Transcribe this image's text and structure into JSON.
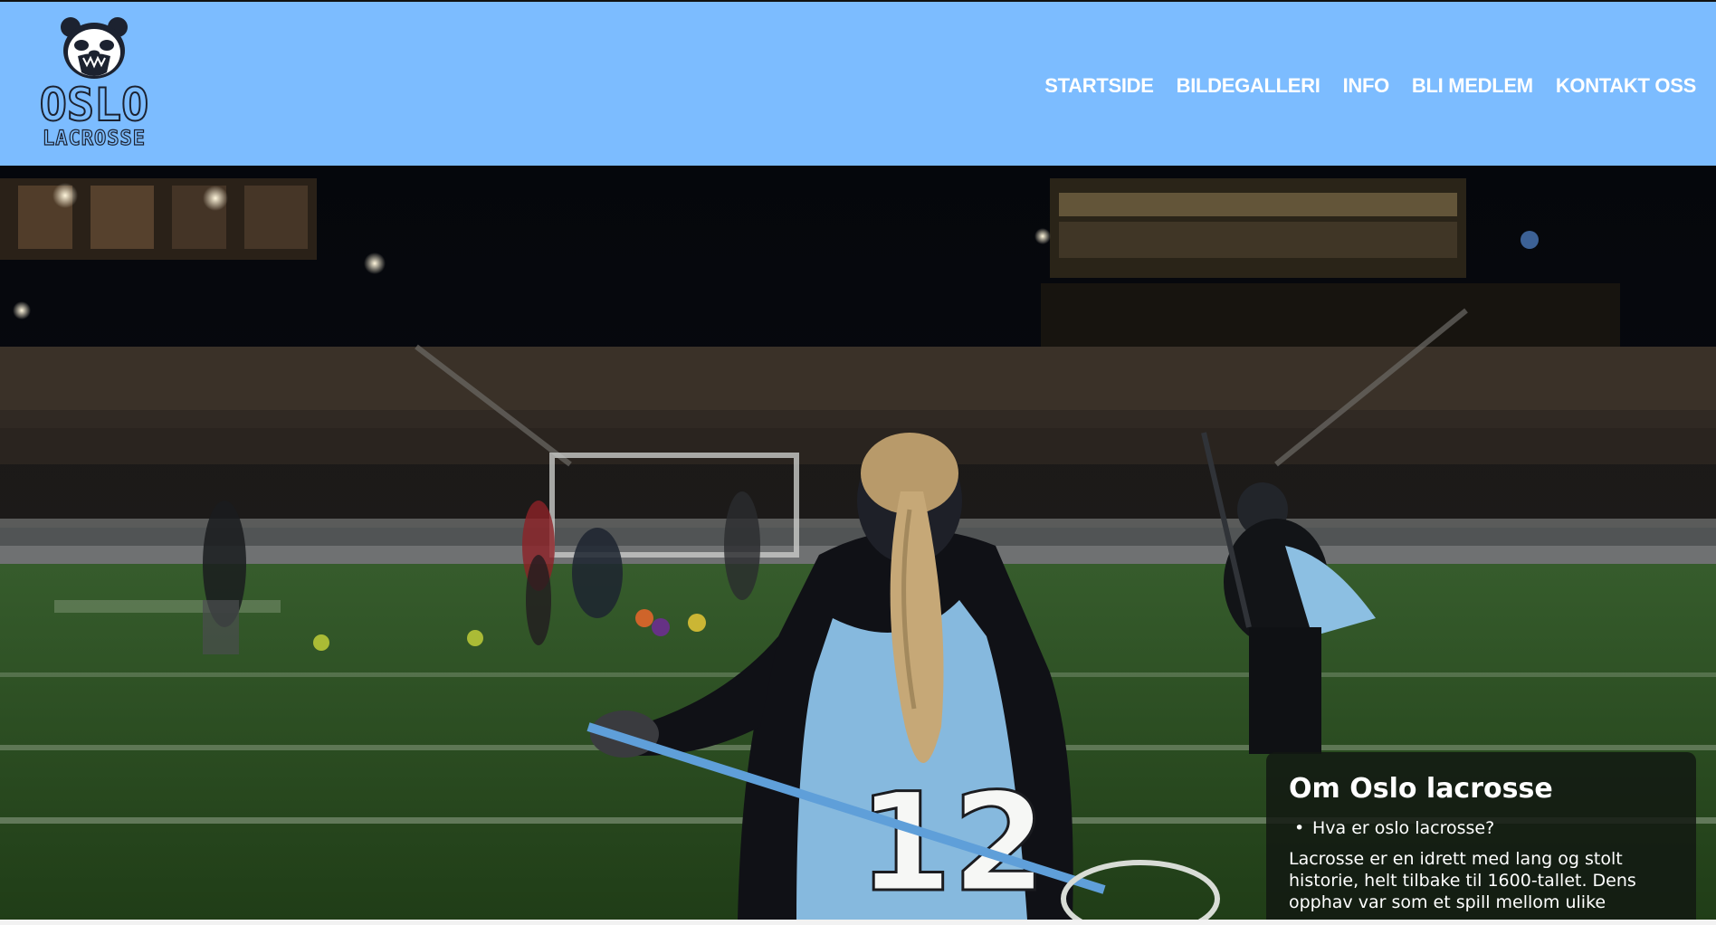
{
  "logo": {
    "word1": "OSLO",
    "word2": "LACROSSE",
    "icon": "panda-icon"
  },
  "nav": {
    "items": [
      {
        "label": "STARTSIDE"
      },
      {
        "label": "BILDEGALLERI"
      },
      {
        "label": "INFO"
      },
      {
        "label": "BLI MEDLEM"
      },
      {
        "label": "KONTAKT OSS"
      }
    ]
  },
  "hero": {
    "jersey_number": "12"
  },
  "info_card": {
    "title": "Om Oslo lacrosse",
    "bullet": "Hva er oslo lacrosse?",
    "text": "Lacrosse er en idrett med lang og stolt historie, helt tilbake til 1600-tallet. Dens opphav var som et spill mellom ulike"
  },
  "colors": {
    "header_bg": "#7cbcff",
    "nav_text": "#ffffff",
    "jersey_blue": "#86b9de",
    "card_bg": "#121812"
  }
}
